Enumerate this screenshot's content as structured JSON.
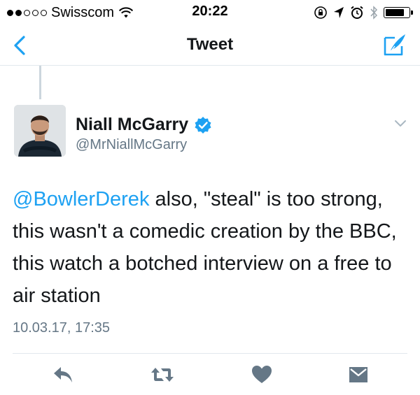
{
  "status_bar": {
    "carrier": "Swisscom",
    "time": "20:22",
    "signal_bars_filled": 2,
    "signal_bars_total": 5,
    "battery_level": 0.8
  },
  "nav": {
    "title": "Tweet",
    "back_icon": "chevron-left-icon",
    "compose_icon": "compose-tweet-icon",
    "accent_color": "#1da1f2"
  },
  "tweet": {
    "author_name": "Niall McGarry",
    "author_handle": "@MrNiallMcGarry",
    "verified": true,
    "mention": "@BowlerDerek",
    "text": " also, \"steal\" is too strong, this wasn't a comedic creation by the BBC, this watch a botched interview on a free to air station",
    "timestamp": "10.03.17, 17:35"
  },
  "actions": [
    {
      "name": "reply",
      "icon": "reply-icon"
    },
    {
      "name": "retweet",
      "icon": "retweet-icon"
    },
    {
      "name": "like",
      "icon": "heart-icon"
    },
    {
      "name": "direct-message",
      "icon": "envelope-icon"
    }
  ],
  "colors": {
    "text": "#14171a",
    "secondary": "#657786",
    "accent": "#1da1f2",
    "icon_gray": "#657786",
    "divider": "#e1e8ed"
  }
}
